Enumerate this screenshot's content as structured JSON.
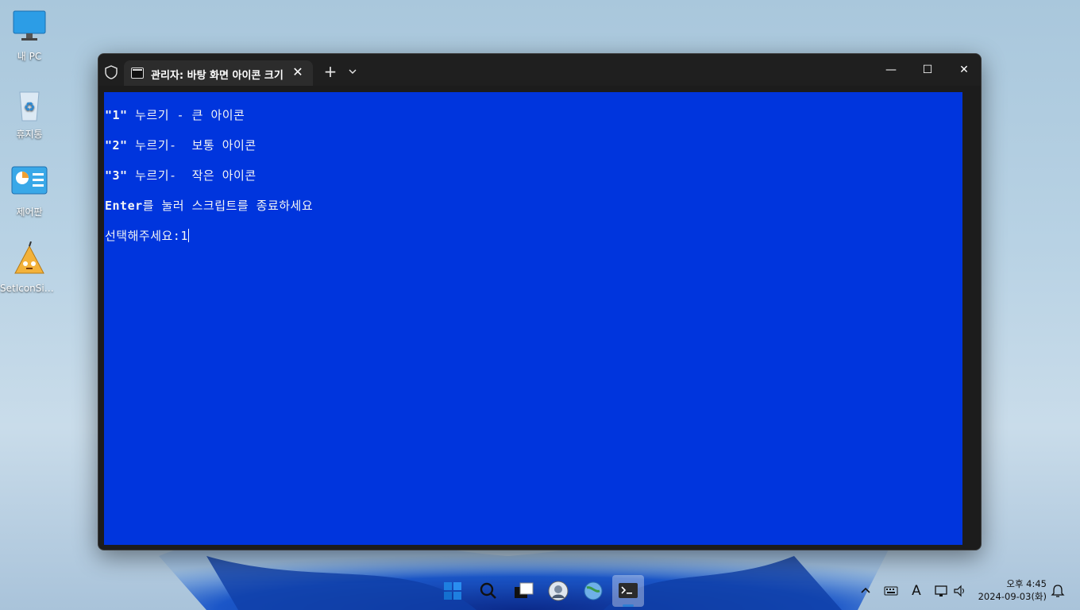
{
  "desktop": {
    "icons": [
      {
        "label": "내 PC",
        "icon": "monitor-icon"
      },
      {
        "label": "휴지통",
        "icon": "recycle-bin-icon"
      },
      {
        "label": "제어판",
        "icon": "control-panel-icon"
      },
      {
        "label": "SetIconSize...",
        "icon": "script-file-icon"
      }
    ]
  },
  "window": {
    "tab_title": "관리자: 바탕 화면 아이콘 크기",
    "tab_close": "✕",
    "new_tab": "+",
    "minimize": "—",
    "maximize": "☐",
    "close": "✕"
  },
  "console": {
    "line1_key": "\"1\"",
    "line1_text": " 누르기 - 큰 아이콘",
    "line2_key": "\"2\"",
    "line2_text": " 누르기-  보통 아이콘",
    "line3_key": "\"3\"",
    "line3_text": " 누르기-  작은 아이콘",
    "line4_key": "Enter",
    "line4_text": "를 눌러 스크립트를 종료하세요",
    "prompt": "선택해주세요:1"
  },
  "taskbar": {
    "apps": [
      "start-icon",
      "search-icon",
      "task-view-icon",
      "app-avatar-icon",
      "globe-icon",
      "terminal-icon"
    ],
    "tray": [
      "chevron-up-icon",
      "keyboard-icon",
      "ime-icon",
      "network-icon",
      "volume-icon",
      "notification-icon"
    ],
    "ime_label": "A",
    "time": "오후 4:45",
    "date": "2024-09-03(화)"
  },
  "colors": {
    "console_bg": "#0035dd",
    "console_fg": "#f5f5f5",
    "titlebar": "#1f1f1f",
    "accent": "#2d7fd4"
  }
}
